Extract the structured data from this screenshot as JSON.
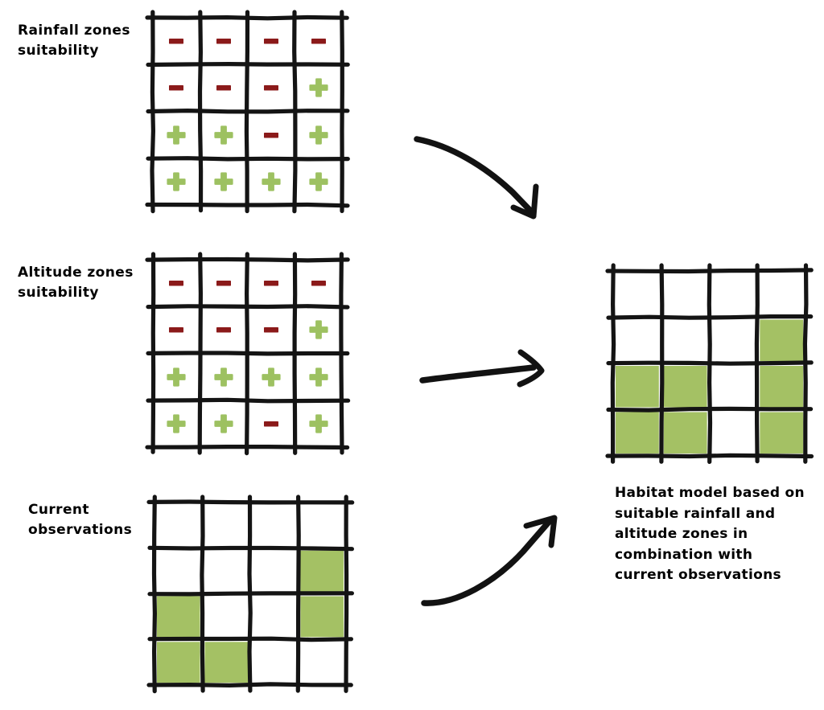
{
  "diagram": {
    "title": "Habitat model based on suitable rainfall and altitude zones in combination with current observations",
    "background_color": "#ffffff",
    "ink_color": "#141414",
    "plus_color": "#9dc161",
    "minus_color": "#8b1a1a",
    "fill_color": "#a4c164"
  },
  "labels": {
    "rainfall": "Rainfall zones\nsuitability",
    "altitude": "Altitude zones\nsuitability",
    "observations": "Current\nobservations"
  },
  "caption": {
    "text": "Habitat model based on\nsuitable rainfall and\naltitude zones in\ncombination with\ncurrent observations"
  },
  "grids": {
    "rainfall": {
      "name": "rainfall-zones-suitability-grid",
      "rows": 4,
      "cols": 4,
      "legend": {
        "plus": "suitable",
        "minus": "unsuitable"
      },
      "cells": [
        [
          "minus",
          "minus",
          "minus",
          "minus"
        ],
        [
          "minus",
          "minus",
          "minus",
          "plus"
        ],
        [
          "plus",
          "plus",
          "minus",
          "plus"
        ],
        [
          "plus",
          "plus",
          "plus",
          "plus"
        ]
      ]
    },
    "altitude": {
      "name": "altitude-zones-suitability-grid",
      "rows": 4,
      "cols": 4,
      "legend": {
        "plus": "suitable",
        "minus": "unsuitable"
      },
      "cells": [
        [
          "minus",
          "minus",
          "minus",
          "minus"
        ],
        [
          "minus",
          "minus",
          "minus",
          "plus"
        ],
        [
          "plus",
          "plus",
          "plus",
          "plus"
        ],
        [
          "plus",
          "plus",
          "minus",
          "plus"
        ]
      ]
    },
    "observations": {
      "name": "current-observations-grid",
      "rows": 4,
      "cols": 4,
      "legend": {
        "filled": "observed",
        "empty": "not observed"
      },
      "cells": [
        [
          "empty",
          "empty",
          "empty",
          "empty"
        ],
        [
          "empty",
          "empty",
          "empty",
          "filled"
        ],
        [
          "filled",
          "empty",
          "empty",
          "filled"
        ],
        [
          "filled",
          "filled",
          "empty",
          "empty"
        ]
      ]
    },
    "result": {
      "name": "habitat-model-result-grid",
      "rows": 4,
      "cols": 4,
      "legend": {
        "filled": "habitat",
        "empty": "no habitat"
      },
      "cells": [
        [
          "empty",
          "empty",
          "empty",
          "empty"
        ],
        [
          "empty",
          "empty",
          "empty",
          "filled"
        ],
        [
          "filled",
          "filled",
          "empty",
          "filled"
        ],
        [
          "filled",
          "filled",
          "empty",
          "filled"
        ]
      ]
    }
  },
  "arrows": [
    {
      "name": "arrow-rainfall-to-result",
      "from": "rainfall-grid",
      "to": "result-grid"
    },
    {
      "name": "arrow-altitude-to-result",
      "from": "altitude-grid",
      "to": "result-grid"
    },
    {
      "name": "arrow-observations-to-result",
      "from": "observations-grid",
      "to": "result-grid"
    }
  ]
}
